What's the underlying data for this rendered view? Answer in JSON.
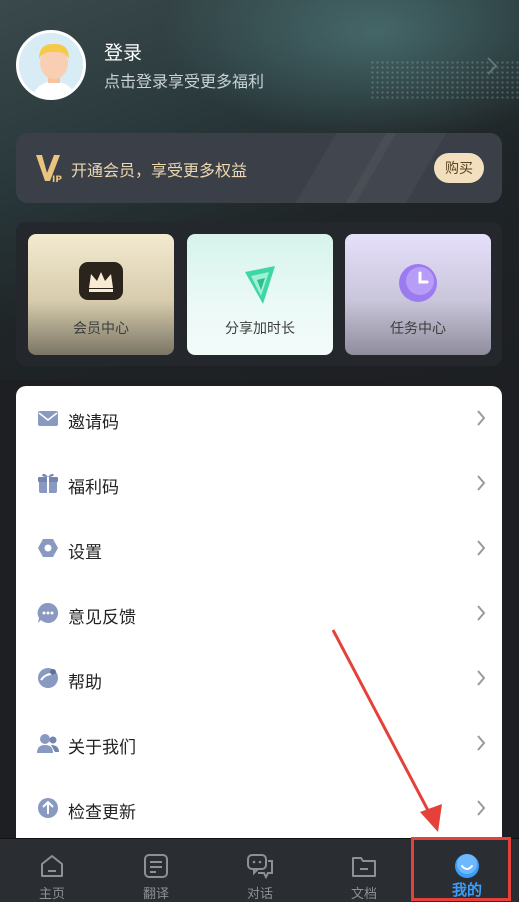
{
  "profile": {
    "title": "登录",
    "subtitle": "点击登录享受更多福利"
  },
  "vip": {
    "text": "开通会员，享受更多权益",
    "buy_label": "购买"
  },
  "features": [
    {
      "label": "会员中心",
      "icon": "crown-icon"
    },
    {
      "label": "分享加时长",
      "icon": "share-icon"
    },
    {
      "label": "任务中心",
      "icon": "clock-icon"
    }
  ],
  "menu": [
    {
      "label": "邀请码",
      "icon": "mail-icon"
    },
    {
      "label": "福利码",
      "icon": "gift-icon"
    },
    {
      "label": "设置",
      "icon": "settings-icon"
    },
    {
      "label": "意见反馈",
      "icon": "feedback-icon"
    },
    {
      "label": "帮助",
      "icon": "help-icon"
    },
    {
      "label": "关于我们",
      "icon": "about-icon"
    },
    {
      "label": "检查更新",
      "icon": "update-icon"
    }
  ],
  "nav": [
    {
      "label": "主页",
      "icon": "home-icon"
    },
    {
      "label": "翻译",
      "icon": "translate-icon"
    },
    {
      "label": "对话",
      "icon": "chat-icon"
    },
    {
      "label": "文档",
      "icon": "folder-icon"
    },
    {
      "label": "我的",
      "icon": "profile-icon",
      "active": true
    }
  ],
  "colors": {
    "accent": "#3d9cf5",
    "highlight": "#e5413b",
    "vip_gold": "#ecd8b0"
  }
}
